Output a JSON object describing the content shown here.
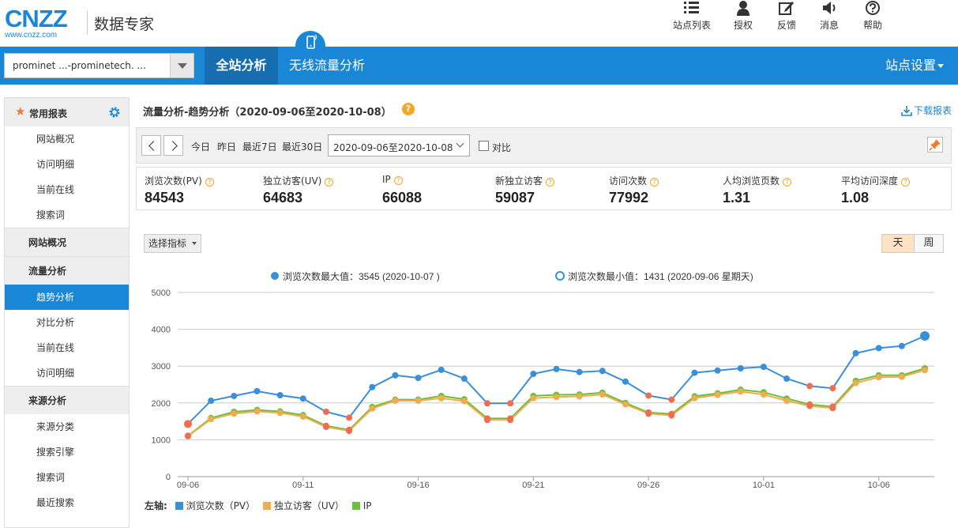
{
  "header": {
    "logo_text": "CNZZ",
    "logo_url": "www.cnzz.com",
    "product": "数据专家",
    "tools": [
      {
        "label": "站点列表",
        "icon": "list-icon"
      },
      {
        "label": "授权",
        "icon": "user-icon"
      },
      {
        "label": "反馈",
        "icon": "edit-icon"
      },
      {
        "label": "消息",
        "icon": "speaker-icon"
      },
      {
        "label": "帮助",
        "icon": "help-icon"
      }
    ]
  },
  "nav": {
    "site_selector": "prominet ...-prominetech. ...",
    "tab_active": "全站分析",
    "tab_mobile": "无线流量分析",
    "site_settings": "站点设置",
    "colors": {
      "nav": "#1a86d6",
      "nav_active": "#166eb1"
    }
  },
  "sidebar": {
    "favorites_label": "常用报表",
    "favorites": [
      "网站概况",
      "访问明细",
      "当前在线",
      "搜索词"
    ],
    "group_overview": "网站概况",
    "group_traffic": "流量分析",
    "traffic_items": [
      "趋势分析",
      "对比分析",
      "当前在线",
      "访问明细"
    ],
    "group_source": "来源分析",
    "source_items": [
      "来源分类",
      "搜索引擎",
      "搜索词",
      "最近搜索"
    ]
  },
  "main": {
    "title": "流量分析-趋势分析（2020-09-06至2020-10-08）",
    "download": "下载报表",
    "quick": [
      "今日",
      "昨日",
      "最近7日",
      "最近30日"
    ],
    "date_range": "2020-09-06至2020-10-08",
    "compare": "对比",
    "metrics": [
      {
        "label": "浏览次数(PV)",
        "value": "84543"
      },
      {
        "label": "独立访客(UV)",
        "value": "64683"
      },
      {
        "label": "IP",
        "value": "66088"
      },
      {
        "label": "新独立访客",
        "value": "59087"
      },
      {
        "label": "访问次数",
        "value": "77992"
      },
      {
        "label": "人均浏览页数",
        "value": "1.31"
      },
      {
        "label": "平均访问深度",
        "value": "1.08"
      }
    ],
    "pick_metric": "选择指标",
    "toggle_day": "天",
    "toggle_week": "周"
  },
  "chart_data": {
    "type": "line",
    "max_note": "浏览次数最大值：3545 (2020-10-07 )",
    "min_note": "浏览次数最小值：1431 (2020-09-06 星期天)",
    "legend_prefix": "左轴:",
    "ylim": [
      0,
      5000
    ],
    "yticks": [
      0,
      1000,
      2000,
      3000,
      4000,
      5000
    ],
    "xticks": [
      "09-06",
      "09-11",
      "09-16",
      "09-21",
      "09-26",
      "10-01",
      "10-06"
    ],
    "x": [
      "09-06",
      "09-07",
      "09-08",
      "09-09",
      "09-10",
      "09-11",
      "09-12",
      "09-13",
      "09-14",
      "09-15",
      "09-16",
      "09-17",
      "09-18",
      "09-19",
      "09-20",
      "09-21",
      "09-22",
      "09-23",
      "09-24",
      "09-25",
      "09-26",
      "09-27",
      "09-28",
      "09-29",
      "09-30",
      "10-01",
      "10-02",
      "10-03",
      "10-04",
      "10-05",
      "10-06",
      "10-07",
      "10-08"
    ],
    "weekend_index": [
      0,
      6,
      7,
      13,
      14,
      20,
      21,
      27,
      28
    ],
    "series": [
      {
        "name": "浏览次数（PV）",
        "color": "#3a8fd9",
        "values": [
          1431,
          2060,
          2190,
          2320,
          2210,
          2120,
          1760,
          1600,
          2430,
          2750,
          2680,
          2900,
          2660,
          1990,
          1990,
          2790,
          2920,
          2840,
          2870,
          2580,
          2200,
          2090,
          2820,
          2880,
          2940,
          2980,
          2660,
          2460,
          2400,
          3350,
          3490,
          3545,
          3820
        ]
      },
      {
        "name": "独立访客（UV）",
        "color": "#f0ad4e",
        "values": [
          1100,
          1560,
          1710,
          1770,
          1730,
          1630,
          1350,
          1240,
          1850,
          2060,
          2060,
          2130,
          2050,
          1540,
          1540,
          2130,
          2160,
          2180,
          2230,
          1960,
          1710,
          1660,
          2130,
          2220,
          2310,
          2230,
          2060,
          1920,
          1860,
          2540,
          2700,
          2710,
          2890
        ]
      },
      {
        "name": "IP",
        "color": "#6cbf3c",
        "values": [
          1110,
          1590,
          1760,
          1810,
          1770,
          1670,
          1380,
          1270,
          1890,
          2090,
          2090,
          2190,
          2100,
          1580,
          1580,
          2190,
          2220,
          2230,
          2280,
          2000,
          1740,
          1700,
          2180,
          2260,
          2360,
          2290,
          2120,
          1960,
          1900,
          2600,
          2750,
          2750,
          2940
        ]
      }
    ]
  }
}
